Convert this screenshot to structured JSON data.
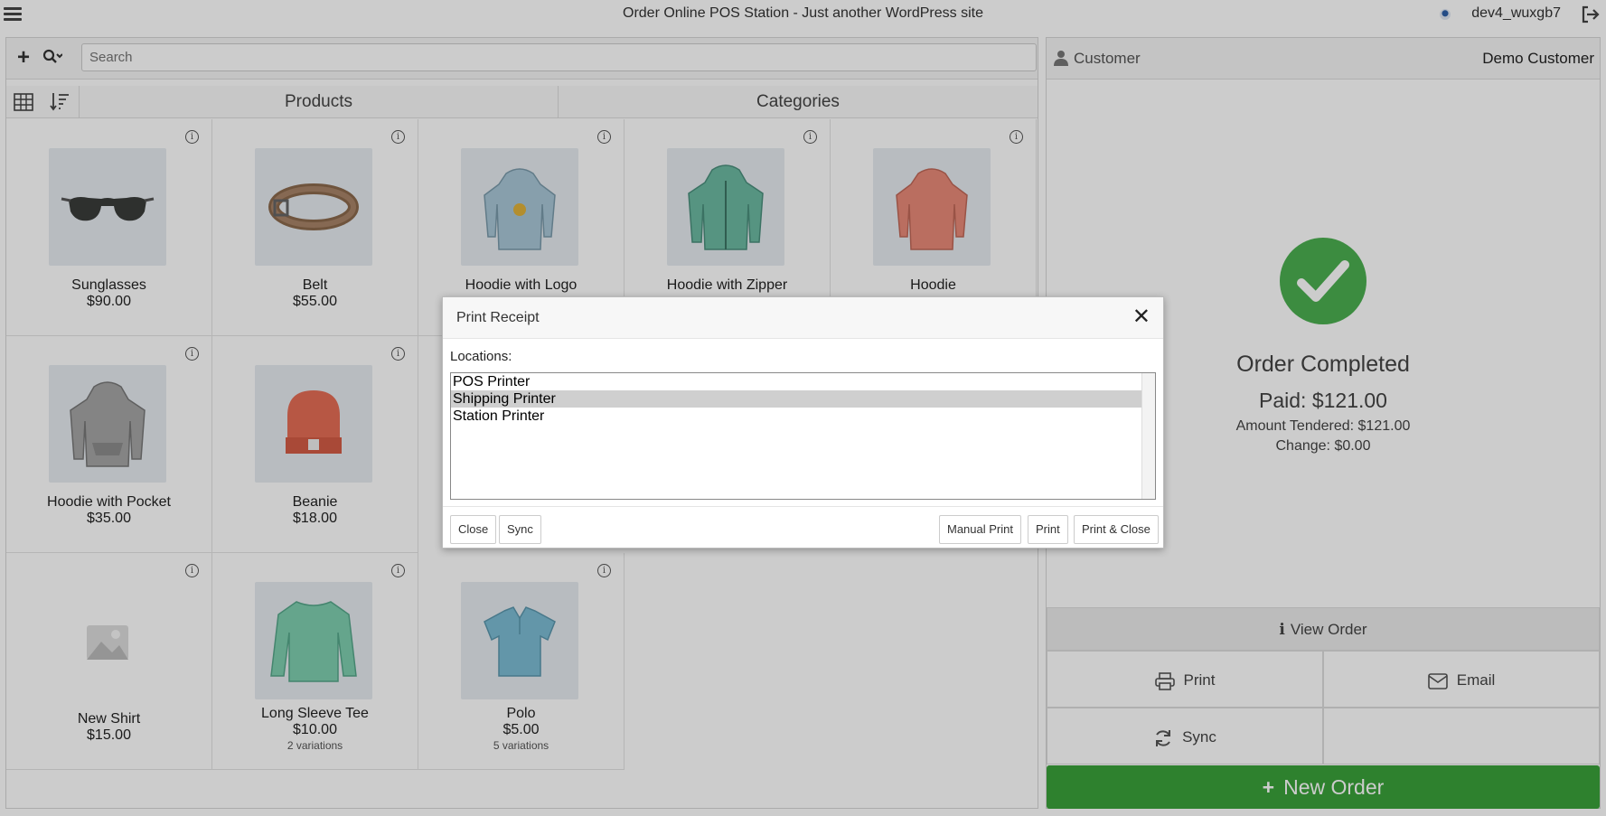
{
  "topbar": {
    "title": "Order Online POS Station - Just another WordPress site",
    "username": "dev4_wuxgb7"
  },
  "search": {
    "placeholder": "Search"
  },
  "tabs": [
    {
      "label": "Products"
    },
    {
      "label": "Categories"
    }
  ],
  "products": [
    {
      "name": "Sunglasses",
      "price": "$90.00",
      "variations": "",
      "icon": "sunglasses"
    },
    {
      "name": "Belt",
      "price": "$55.00",
      "variations": "",
      "icon": "belt"
    },
    {
      "name": "Hoodie with Logo",
      "price": "",
      "variations": "",
      "icon": "hoodie-logo"
    },
    {
      "name": "Hoodie with Zipper",
      "price": "",
      "variations": "",
      "icon": "hoodie-zipper"
    },
    {
      "name": "Hoodie",
      "price": "",
      "variations": "",
      "icon": "hoodie"
    },
    {
      "name": "Hoodie with Pocket",
      "price": "$35.00",
      "variations": "",
      "icon": "hoodie-pocket"
    },
    {
      "name": "Beanie",
      "price": "$18.00",
      "variations": "",
      "icon": "beanie"
    },
    {
      "name": "New Shirt",
      "price": "$15.00",
      "variations": "",
      "icon": "placeholder-image"
    },
    {
      "name": "Long Sleeve Tee",
      "price": "$10.00",
      "variations": "2 variations",
      "icon": "long-sleeve-tee"
    },
    {
      "name": "Polo",
      "price": "$5.00",
      "variations": "5 variations",
      "icon": "polo"
    }
  ],
  "customer": {
    "label": "Customer",
    "value": "Demo Customer"
  },
  "order": {
    "status": "Order Completed",
    "paid": "Paid: $121.00",
    "tendered": "Amount Tendered: $121.00",
    "change": "Change: $0.00"
  },
  "actions": {
    "view_order": "View Order",
    "print": "Print",
    "email": "Email",
    "sync": "Sync",
    "new_order": "New Order"
  },
  "modal": {
    "title": "Print Receipt",
    "locations_label": "Locations:",
    "options": [
      "POS Printer",
      "Shipping Printer",
      "Station Printer"
    ],
    "selected": "Shipping Printer",
    "buttons": {
      "close": "Close",
      "sync": "Sync",
      "manual_print": "Manual Print",
      "print": "Print",
      "print_close": "Print & Close"
    }
  },
  "colors": {
    "success": "#4caf50",
    "new_order": "#3aa23a",
    "selected_option": "#cfcfcf"
  }
}
